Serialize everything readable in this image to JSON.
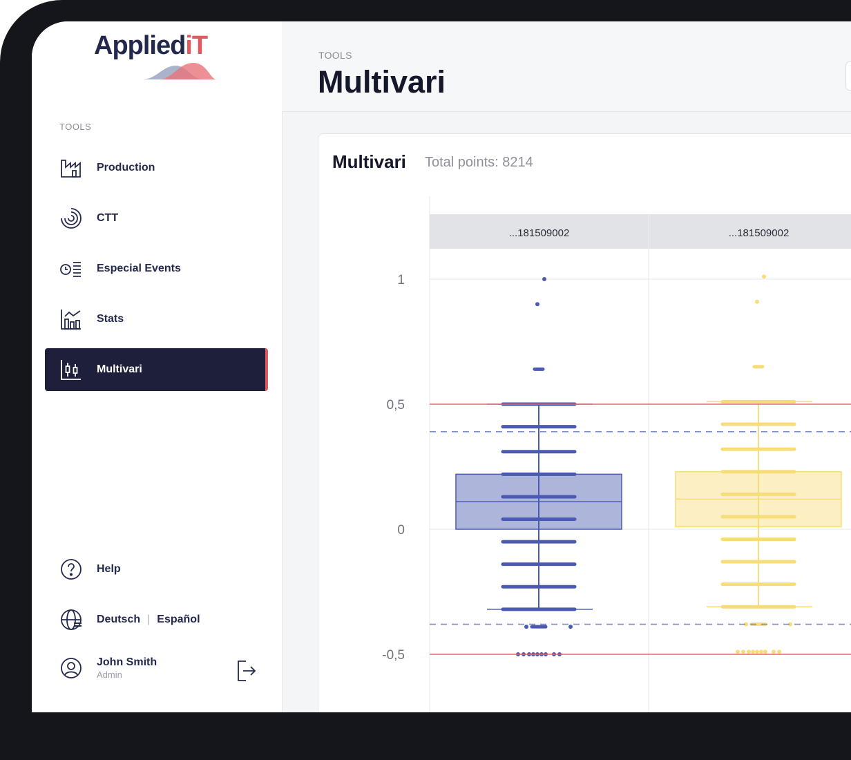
{
  "app": {
    "logo_main": "Applied",
    "logo_accent": "iT"
  },
  "sidebar": {
    "section_label": "TOOLS",
    "items": [
      {
        "label": "Production",
        "icon": "factory-icon"
      },
      {
        "label": "CTT",
        "icon": "radar-icon"
      },
      {
        "label": "Especial Events",
        "icon": "clock-list-icon"
      },
      {
        "label": "Stats",
        "icon": "stats-chart-icon"
      },
      {
        "label": "Multivari",
        "icon": "candlestick-icon",
        "active": true
      }
    ],
    "help_label": "Help",
    "languages": [
      "Deutsch",
      "Español"
    ],
    "user": {
      "name": "John Smith",
      "role": "Admin"
    }
  },
  "header": {
    "breadcrumb": "TOOLS",
    "title": "Multivari"
  },
  "card": {
    "title": "Multivari",
    "subtitle": "Total points: 8214"
  },
  "colors": {
    "series_blue": "#4a5ab0",
    "series_yellow": "#f7dc7a",
    "limit_red": "#e8666a",
    "dashed_blue": "#7f8ad6",
    "active_bg": "#1d1f3b",
    "accent_red": "#e0595e"
  },
  "chart_data": {
    "type": "box",
    "panels": [
      {
        "label": "...181509002",
        "color": "#4a5ab0",
        "box": {
          "q1": 0.0,
          "median": 0.11,
          "q3": 0.22,
          "whisker_low": -0.32,
          "whisker_high": 0.5
        },
        "levels": [
          0.5,
          0.41,
          0.31,
          0.22,
          0.13,
          0.04,
          -0.05,
          -0.14,
          -0.23,
          -0.32
        ],
        "outliers": [
          1.0,
          0.9,
          0.64,
          -0.39,
          -0.5
        ]
      },
      {
        "label": "...181509002",
        "color": "#f7dc7a",
        "box": {
          "q1": 0.01,
          "median": 0.12,
          "q3": 0.23,
          "whisker_low": -0.31,
          "whisker_high": 0.51
        },
        "levels": [
          0.51,
          0.42,
          0.32,
          0.23,
          0.14,
          0.05,
          -0.04,
          -0.13,
          -0.22,
          -0.31
        ],
        "outliers": [
          1.01,
          0.91,
          0.65,
          -0.38,
          -0.49
        ]
      }
    ],
    "y_ticks": [
      "1",
      "0,5",
      "0",
      "-0,5"
    ],
    "y_tick_values": [
      1,
      0.5,
      0,
      -0.5
    ],
    "ylim": [
      -0.75,
      1.12
    ],
    "limits_solid": [
      0.5,
      -0.5
    ],
    "limits_dashed": [
      0.39,
      -0.38
    ],
    "grid": true
  }
}
